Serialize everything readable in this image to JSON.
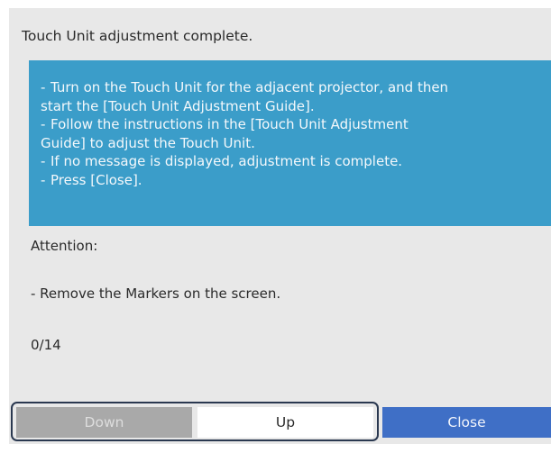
{
  "dialog": {
    "title": "Touch Unit adjustment complete.",
    "instructions": [
      {
        "bullet": "-",
        "text": "Turn on the Touch Unit for the adjacent projector, and then",
        "continuation": "start the [Touch Unit Adjustment Guide]."
      },
      {
        "bullet": "-",
        "text": "Follow the instructions in the [Touch Unit Adjustment",
        "continuation": "Guide] to adjust the Touch Unit."
      },
      {
        "bullet": "-",
        "text": "If no message is displayed, adjustment is complete.",
        "continuation": ""
      },
      {
        "bullet": "-",
        "text": "Press [Close].",
        "continuation": ""
      }
    ],
    "attention_label": "Attention:",
    "attention_note": "- Remove the Markers on the screen.",
    "page_counter": "0/14"
  },
  "buttons": {
    "down_label": "Down",
    "up_label": "Up",
    "close_label": "Close"
  },
  "colors": {
    "panel_background": "#e8e8e8",
    "info_box": "#3b9dc9",
    "close_button": "#3f6fc6",
    "disabled_button": "#a9a9a9",
    "focus_ring": "#2a3850"
  }
}
